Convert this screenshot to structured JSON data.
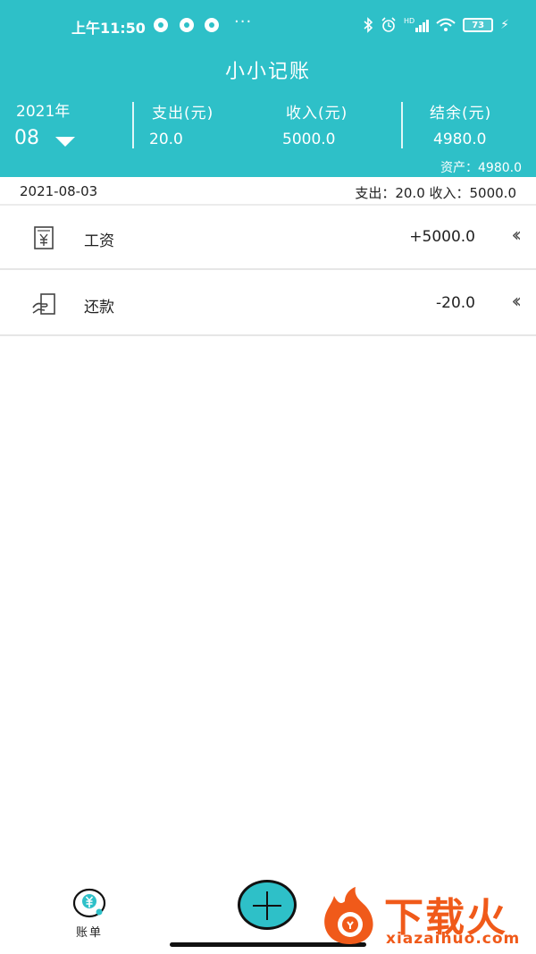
{
  "status_bar": {
    "time": "上午11:50",
    "more": "···",
    "battery": "73",
    "hd": "HD"
  },
  "app": {
    "title": "小小记账"
  },
  "summary": {
    "year": "2021年",
    "month": "08",
    "expense_label": "支出(元)",
    "expense_value": "20.0",
    "income_label": "收入(元)",
    "income_value": "5000.0",
    "balance_label": "结余(元)",
    "balance_value": "4980.0",
    "assets": "资产：4980.0"
  },
  "day_header": {
    "date": "2021-08-03",
    "totals": "支出：20.0 收入：5000.0"
  },
  "records": [
    {
      "name": "工资",
      "amount": "+5000.0",
      "icon": "yuan-note-icon"
    },
    {
      "name": "还款",
      "amount": "-20.0",
      "icon": "repayment-icon"
    }
  ],
  "tabbar": {
    "bill_label": "账单"
  },
  "watermark": {
    "brand": "下载火",
    "url": "xiazaihuo.com"
  },
  "colors": {
    "primary": "#2ec0c8",
    "watermark": "#f05a1a"
  }
}
